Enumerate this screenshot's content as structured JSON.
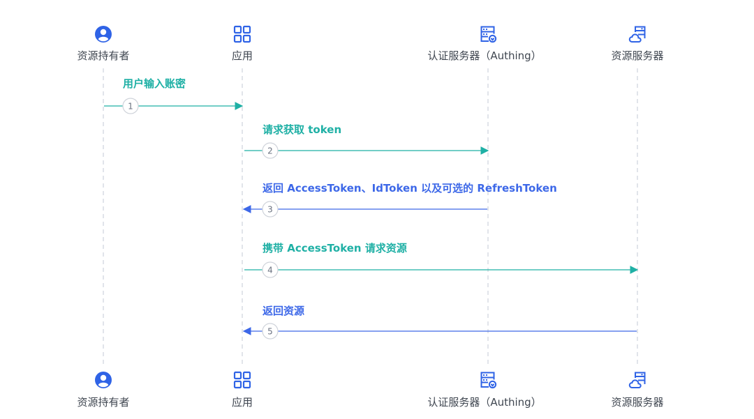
{
  "diagram": {
    "actors": [
      {
        "id": "owner",
        "label": "资源持有者",
        "icon": "user-icon"
      },
      {
        "id": "app",
        "label": "应用",
        "icon": "apps-grid-icon"
      },
      {
        "id": "auth",
        "label": "认证服务器（Authing）",
        "icon": "auth-server-icon"
      },
      {
        "id": "resource",
        "label": "资源服务器",
        "icon": "cloud-server-icon"
      }
    ],
    "messages": [
      {
        "step": "1",
        "label": "用户输入账密",
        "from": "owner",
        "to": "app",
        "color": "#1fb0a5"
      },
      {
        "step": "2",
        "label": "请求获取 token",
        "from": "app",
        "to": "auth",
        "color": "#1fb0a5"
      },
      {
        "step": "3",
        "label": "返回 AccessToken、IdToken 以及可选的 RefreshToken",
        "from": "auth",
        "to": "app",
        "color": "#3d68e8"
      },
      {
        "step": "4",
        "label": "携带 AccessToken 请求资源",
        "from": "app",
        "to": "resource",
        "color": "#1fb0a5"
      },
      {
        "step": "5",
        "label": "返回资源",
        "from": "resource",
        "to": "app",
        "color": "#3d68e8"
      }
    ],
    "colors": {
      "icon": "#2f63e6",
      "request": "#1fb0a5",
      "response": "#3d68e8",
      "lifeline": "#d7dbe3"
    }
  }
}
